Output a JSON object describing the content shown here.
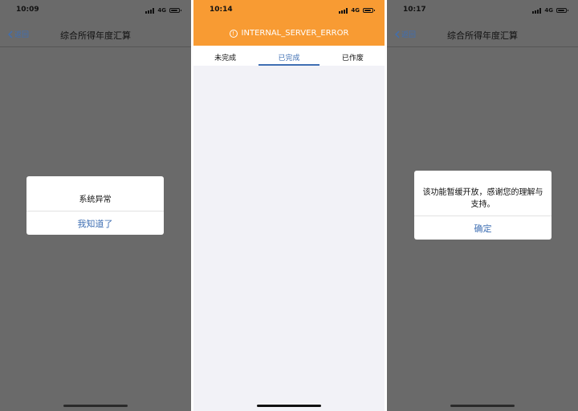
{
  "screens": [
    {
      "time": "10:09",
      "network": "4G",
      "nav": {
        "back_label": "返回",
        "title": "综合所得年度汇算"
      },
      "alert": {
        "message": "系统异常",
        "button": "我知道了"
      }
    },
    {
      "time": "10:14",
      "network": "4G",
      "banner": {
        "message": "INTERNAL_SERVER_ERROR",
        "icon": "exclamation-circle-icon"
      },
      "tabs": [
        {
          "label": "未完成",
          "active": false
        },
        {
          "label": "已完成",
          "active": true
        },
        {
          "label": "已作废",
          "active": false
        }
      ]
    },
    {
      "time": "10:17",
      "network": "4G",
      "nav": {
        "back_label": "返回",
        "title": "综合所得年度汇算"
      },
      "alert": {
        "message": "该功能暂缓开放，感谢您的理解与支持。",
        "button": "确定"
      }
    }
  ],
  "colors": {
    "accent": "#3f6fb3",
    "banner": "#f89b33",
    "overlay": "#6a6a6a",
    "content_bg": "#f2f2f7"
  }
}
